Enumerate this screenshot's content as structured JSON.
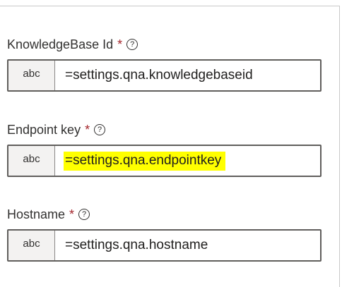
{
  "fields": [
    {
      "label": "KnowledgeBase Id",
      "required_mark": "*",
      "help_glyph": "?",
      "type_badge": "abc",
      "value": "=settings.qna.knowledgebaseid",
      "highlighted": false
    },
    {
      "label": "Endpoint key",
      "required_mark": "*",
      "help_glyph": "?",
      "type_badge": "abc",
      "value": "=settings.qna.endpointkey",
      "highlighted": true
    },
    {
      "label": "Hostname",
      "required_mark": "*",
      "help_glyph": "?",
      "type_badge": "abc",
      "value": "=settings.qna.hostname",
      "highlighted": false
    }
  ],
  "colors": {
    "highlight": "#ffff00",
    "required": "#a4262c",
    "border": "#605e5c",
    "badge_bg": "#f3f2f1"
  }
}
